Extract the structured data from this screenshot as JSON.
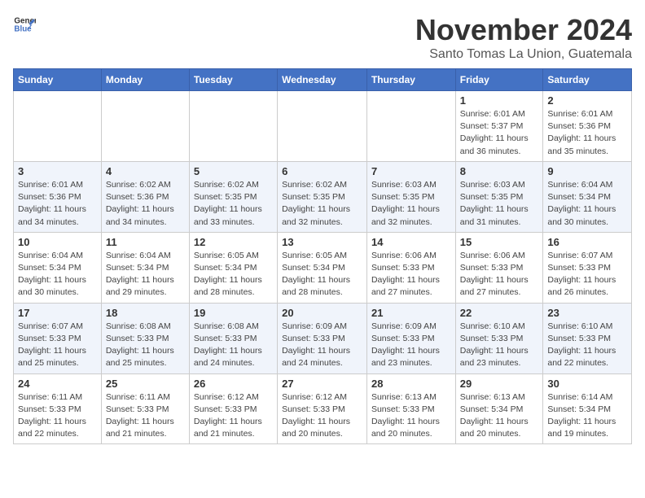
{
  "header": {
    "logo_general": "General",
    "logo_blue": "Blue",
    "title": "November 2024",
    "subtitle": "Santo Tomas La Union, Guatemala"
  },
  "days_of_week": [
    "Sunday",
    "Monday",
    "Tuesday",
    "Wednesday",
    "Thursday",
    "Friday",
    "Saturday"
  ],
  "weeks": [
    [
      {
        "day": "",
        "info": ""
      },
      {
        "day": "",
        "info": ""
      },
      {
        "day": "",
        "info": ""
      },
      {
        "day": "",
        "info": ""
      },
      {
        "day": "",
        "info": ""
      },
      {
        "day": "1",
        "info": "Sunrise: 6:01 AM\nSunset: 5:37 PM\nDaylight: 11 hours and 36 minutes."
      },
      {
        "day": "2",
        "info": "Sunrise: 6:01 AM\nSunset: 5:36 PM\nDaylight: 11 hours and 35 minutes."
      }
    ],
    [
      {
        "day": "3",
        "info": "Sunrise: 6:01 AM\nSunset: 5:36 PM\nDaylight: 11 hours and 34 minutes."
      },
      {
        "day": "4",
        "info": "Sunrise: 6:02 AM\nSunset: 5:36 PM\nDaylight: 11 hours and 34 minutes."
      },
      {
        "day": "5",
        "info": "Sunrise: 6:02 AM\nSunset: 5:35 PM\nDaylight: 11 hours and 33 minutes."
      },
      {
        "day": "6",
        "info": "Sunrise: 6:02 AM\nSunset: 5:35 PM\nDaylight: 11 hours and 32 minutes."
      },
      {
        "day": "7",
        "info": "Sunrise: 6:03 AM\nSunset: 5:35 PM\nDaylight: 11 hours and 32 minutes."
      },
      {
        "day": "8",
        "info": "Sunrise: 6:03 AM\nSunset: 5:35 PM\nDaylight: 11 hours and 31 minutes."
      },
      {
        "day": "9",
        "info": "Sunrise: 6:04 AM\nSunset: 5:34 PM\nDaylight: 11 hours and 30 minutes."
      }
    ],
    [
      {
        "day": "10",
        "info": "Sunrise: 6:04 AM\nSunset: 5:34 PM\nDaylight: 11 hours and 30 minutes."
      },
      {
        "day": "11",
        "info": "Sunrise: 6:04 AM\nSunset: 5:34 PM\nDaylight: 11 hours and 29 minutes."
      },
      {
        "day": "12",
        "info": "Sunrise: 6:05 AM\nSunset: 5:34 PM\nDaylight: 11 hours and 28 minutes."
      },
      {
        "day": "13",
        "info": "Sunrise: 6:05 AM\nSunset: 5:34 PM\nDaylight: 11 hours and 28 minutes."
      },
      {
        "day": "14",
        "info": "Sunrise: 6:06 AM\nSunset: 5:33 PM\nDaylight: 11 hours and 27 minutes."
      },
      {
        "day": "15",
        "info": "Sunrise: 6:06 AM\nSunset: 5:33 PM\nDaylight: 11 hours and 27 minutes."
      },
      {
        "day": "16",
        "info": "Sunrise: 6:07 AM\nSunset: 5:33 PM\nDaylight: 11 hours and 26 minutes."
      }
    ],
    [
      {
        "day": "17",
        "info": "Sunrise: 6:07 AM\nSunset: 5:33 PM\nDaylight: 11 hours and 25 minutes."
      },
      {
        "day": "18",
        "info": "Sunrise: 6:08 AM\nSunset: 5:33 PM\nDaylight: 11 hours and 25 minutes."
      },
      {
        "day": "19",
        "info": "Sunrise: 6:08 AM\nSunset: 5:33 PM\nDaylight: 11 hours and 24 minutes."
      },
      {
        "day": "20",
        "info": "Sunrise: 6:09 AM\nSunset: 5:33 PM\nDaylight: 11 hours and 24 minutes."
      },
      {
        "day": "21",
        "info": "Sunrise: 6:09 AM\nSunset: 5:33 PM\nDaylight: 11 hours and 23 minutes."
      },
      {
        "day": "22",
        "info": "Sunrise: 6:10 AM\nSunset: 5:33 PM\nDaylight: 11 hours and 23 minutes."
      },
      {
        "day": "23",
        "info": "Sunrise: 6:10 AM\nSunset: 5:33 PM\nDaylight: 11 hours and 22 minutes."
      }
    ],
    [
      {
        "day": "24",
        "info": "Sunrise: 6:11 AM\nSunset: 5:33 PM\nDaylight: 11 hours and 22 minutes."
      },
      {
        "day": "25",
        "info": "Sunrise: 6:11 AM\nSunset: 5:33 PM\nDaylight: 11 hours and 21 minutes."
      },
      {
        "day": "26",
        "info": "Sunrise: 6:12 AM\nSunset: 5:33 PM\nDaylight: 11 hours and 21 minutes."
      },
      {
        "day": "27",
        "info": "Sunrise: 6:12 AM\nSunset: 5:33 PM\nDaylight: 11 hours and 20 minutes."
      },
      {
        "day": "28",
        "info": "Sunrise: 6:13 AM\nSunset: 5:33 PM\nDaylight: 11 hours and 20 minutes."
      },
      {
        "day": "29",
        "info": "Sunrise: 6:13 AM\nSunset: 5:34 PM\nDaylight: 11 hours and 20 minutes."
      },
      {
        "day": "30",
        "info": "Sunrise: 6:14 AM\nSunset: 5:34 PM\nDaylight: 11 hours and 19 minutes."
      }
    ]
  ]
}
